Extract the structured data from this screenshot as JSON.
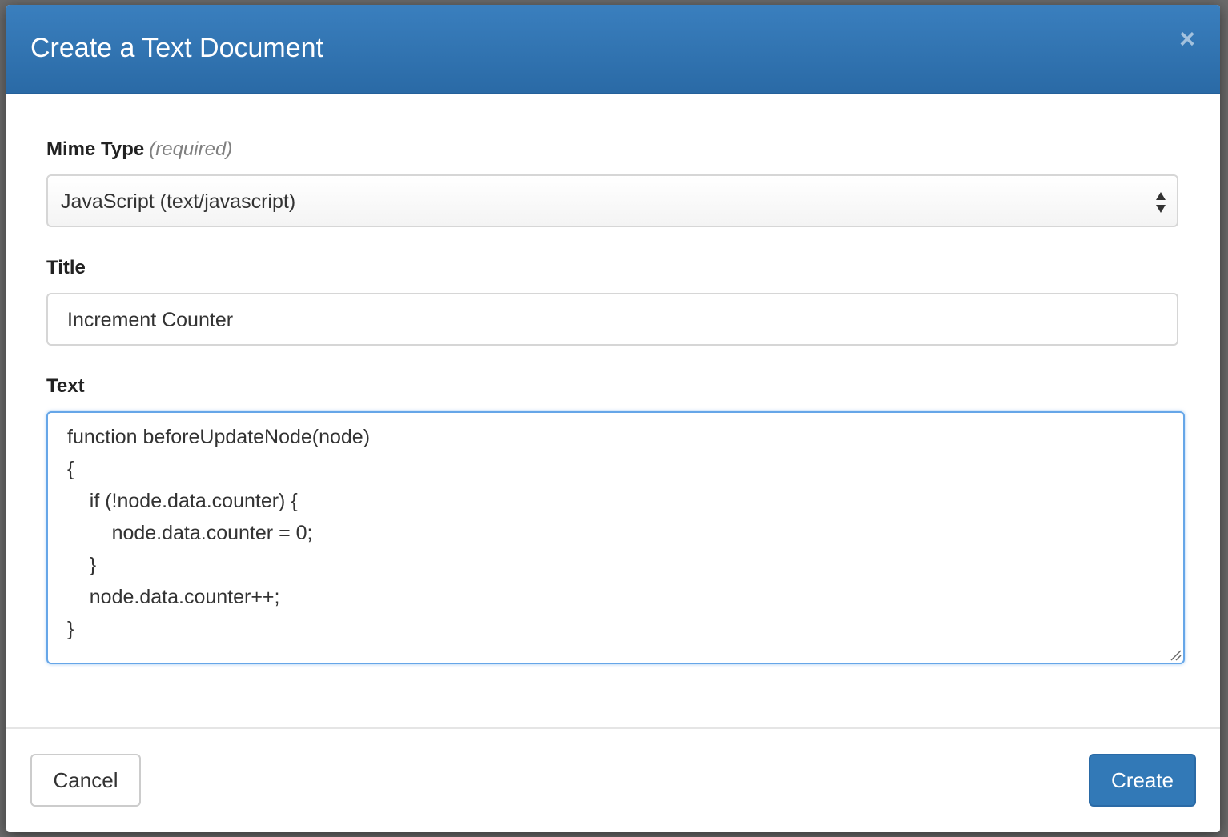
{
  "dialog": {
    "title": "Create a Text Document",
    "close_glyph": "×",
    "close_icon": "close-icon"
  },
  "form": {
    "mime_type": {
      "label": "Mime Type",
      "note": "(required)",
      "selected_value": "JavaScript (text/javascript)",
      "arrows_icon": "select-updown-icon"
    },
    "title": {
      "label": "Title",
      "value": "Increment Counter"
    },
    "text": {
      "label": "Text",
      "lines": [
        "function beforeUpdateNode(node)",
        "{",
        "    if (!node.data.counter) {",
        "        node.data.counter = 0;",
        "    }",
        "    node.data.counter++;",
        "}"
      ]
    }
  },
  "footer": {
    "cancel_label": "Cancel",
    "create_label": "Create"
  },
  "colors": {
    "header": "#2f74b2",
    "primary_button": "#3279b7",
    "focus_border": "#66a6e8"
  }
}
